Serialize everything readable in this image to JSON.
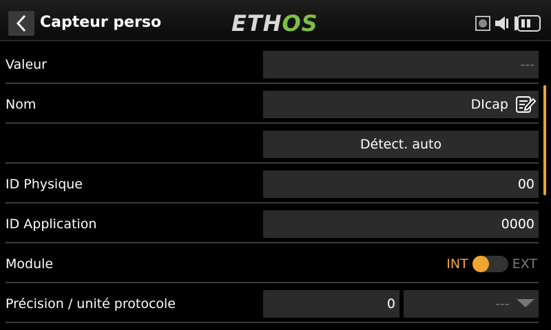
{
  "header": {
    "title": "Capteur perso",
    "logo_left": "ETH",
    "logo_right": "OS"
  },
  "rows": {
    "valeur": {
      "label": "Valeur",
      "value": "---"
    },
    "nom": {
      "label": "Nom",
      "value": "DIcap"
    },
    "detect": {
      "button_label": "Détect. auto"
    },
    "id_physique": {
      "label": "ID Physique",
      "value": "00"
    },
    "id_application": {
      "label": "ID Application",
      "value": "0000"
    },
    "module": {
      "label": "Module",
      "option_int": "INT",
      "option_ext": "EXT",
      "selected": "INT"
    },
    "precision": {
      "label": "Précision / unité protocole",
      "precision_value": "0",
      "unit_value": "---"
    }
  },
  "colors": {
    "accent": "#f0a52e",
    "logo_green": "#7ec13f",
    "field_bg": "#2b2b2b",
    "background": "#000000"
  },
  "icons": [
    "back-arrow-icon",
    "sd-card-icon",
    "speaker-icon",
    "battery-icon",
    "edit-icon",
    "dropdown-arrow-icon"
  ]
}
